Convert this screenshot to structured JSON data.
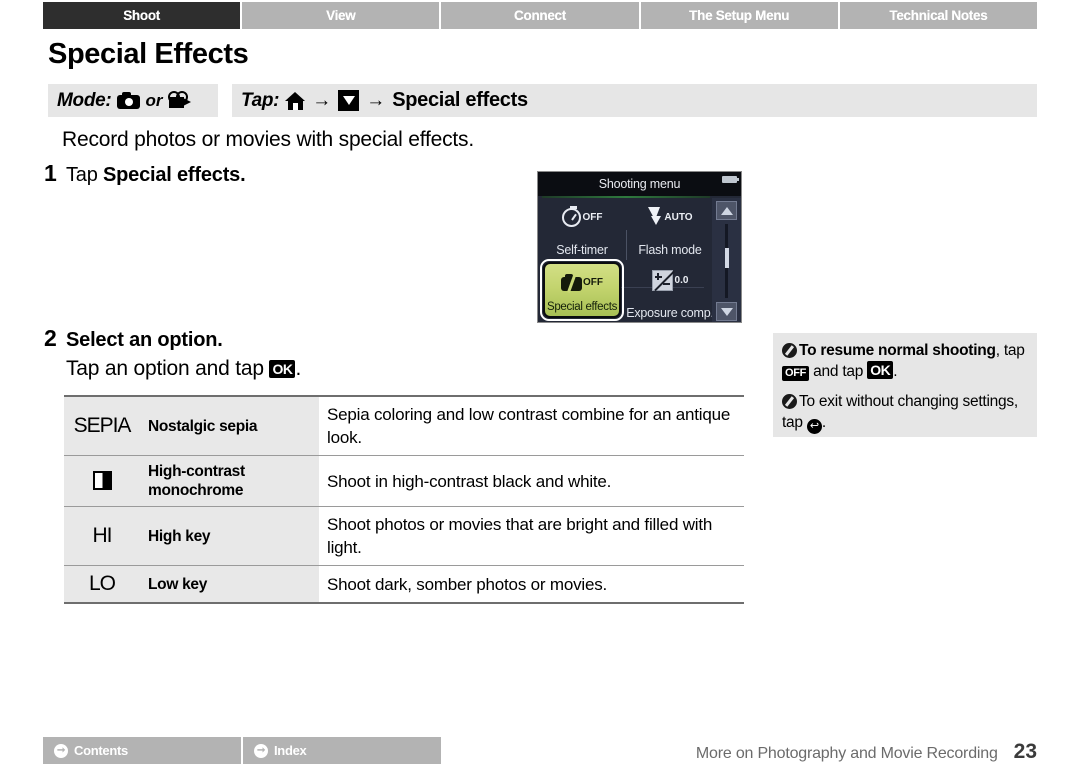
{
  "header": {
    "tabs": [
      {
        "label": "Shoot",
        "active": true
      },
      {
        "label": "View",
        "active": false
      },
      {
        "label": "Connect",
        "active": false
      },
      {
        "label": "The Setup Menu",
        "active": false
      },
      {
        "label": "Technical Notes",
        "active": false
      }
    ]
  },
  "page": {
    "title": "Special Effects",
    "intro": "Record photos or movies with special effects."
  },
  "modebar": {
    "mode_label": "Mode:",
    "or_label": "or",
    "mode_icon_1": "still-camera-icon",
    "mode_icon_2": "movie-camera-icon",
    "tap_label": "Tap:",
    "tap_icon_1": "home-icon",
    "tap_arrow_1": "→",
    "tap_icon_2": "menu-down-icon",
    "tap_arrow_2": "→",
    "tap_target": "Special effects"
  },
  "steps": [
    {
      "number": "1",
      "title_prefix": "Tap ",
      "title_bold": "Special effects."
    },
    {
      "number": "2",
      "title_prefix": "",
      "title_bold": "Select an option.",
      "substep_before": "Tap an option and tap ",
      "substep_key": "OK",
      "substep_after": "."
    }
  ],
  "camera": {
    "title": "Shooting menu",
    "battery_icon": "battery-icon",
    "cells": [
      {
        "label": "Self-timer",
        "value": "OFF",
        "icon": "self-timer-icon"
      },
      {
        "label": "Flash mode",
        "value": "AUTO",
        "icon": "flash-icon"
      },
      {
        "label": "Special effects",
        "value": "OFF",
        "icon": "special-effects-icon",
        "selected": true
      },
      {
        "label": "Exposure comp.",
        "value": "0.0",
        "icon": "exposure-comp-icon"
      }
    ],
    "scroll_up_icon": "triangle-up-icon",
    "scroll_down_icon": "triangle-down-icon"
  },
  "note": {
    "icon": "pencil-icon",
    "p1_bold": "To resume normal shooting",
    "p1_mid": ", tap ",
    "p1_key_off": "OFF",
    "p1_mid2": " and tap ",
    "p1_key_ok": "OK",
    "p1_end": ".",
    "p2_text_a": "To exit without changing settings, tap ",
    "p2_key_back": "↩",
    "p2_end": "."
  },
  "options_table": {
    "rows": [
      {
        "icon_text": "SEPIA",
        "icon_type": "text",
        "name": "Nostalgic sepia",
        "desc": "Sepia coloring and low contrast combine for an antique look."
      },
      {
        "icon_text": "",
        "icon_type": "mono-square-icon",
        "name": "High-contrast monochrome",
        "desc": "Shoot in high-contrast black and white."
      },
      {
        "icon_text": "HI",
        "icon_type": "text",
        "name": "High key",
        "desc": "Shoot photos or movies that are bright and filled with light."
      },
      {
        "icon_text": "LO",
        "icon_type": "text",
        "name": "Low key",
        "desc": "Shoot dark, somber photos or movies."
      }
    ]
  },
  "footer": {
    "tabs": [
      {
        "label": "Contents",
        "icon": "arrow-circle-icon"
      },
      {
        "label": "Index",
        "icon": "arrow-circle-icon"
      }
    ],
    "section": "More on Photography and Movie Recording",
    "page_number": "23"
  },
  "colors": {
    "tab_inactive": "#b3b3b3",
    "tab_active": "#2e2e2e",
    "bar_gray": "#e6e6e6",
    "table_label_gray": "#e8e8e8",
    "camera_bg": "#232836",
    "highlight_green": "#c3d46e"
  }
}
